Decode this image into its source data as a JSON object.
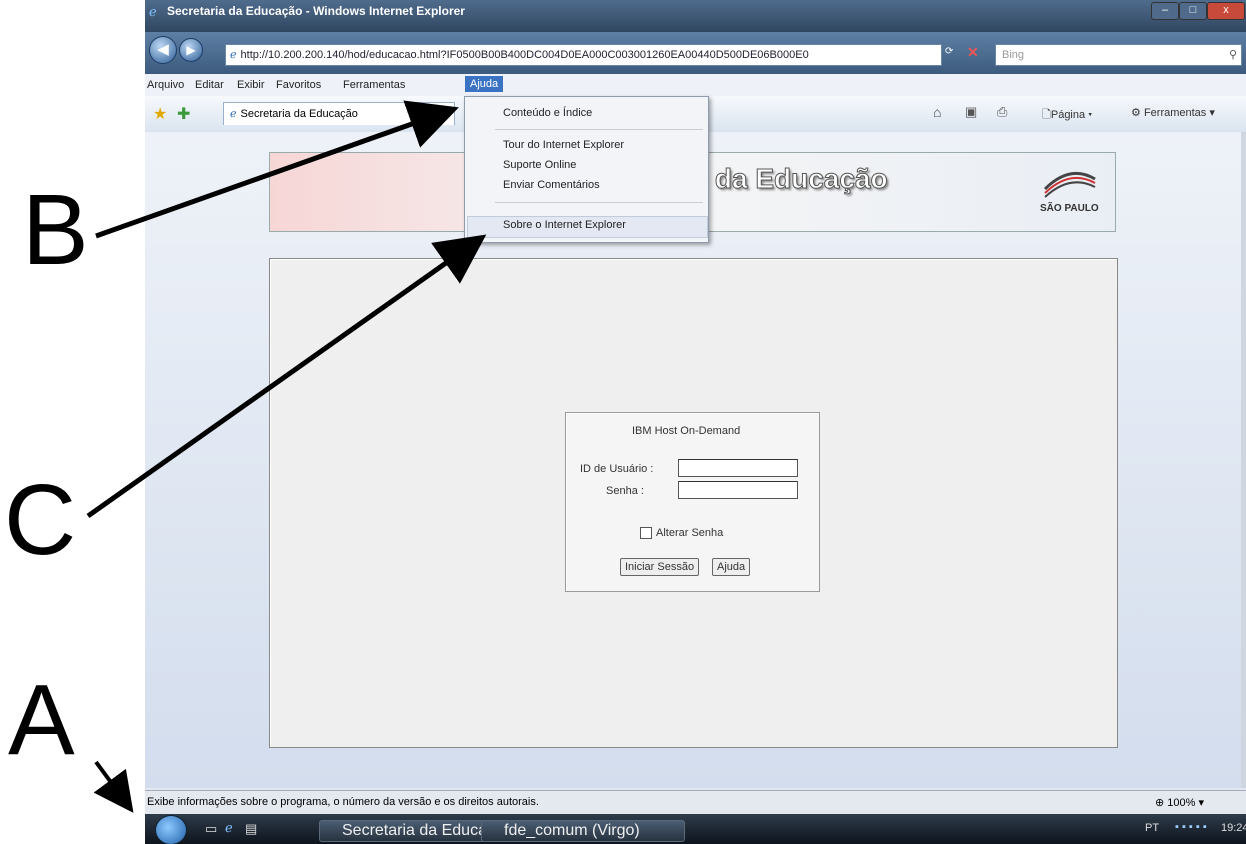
{
  "window": {
    "title": "Secretaria da Educação - Windows Internet Explorer",
    "url": "http://10.200.200.140/hod/educacao.html?IF0500B00B400DC004D0EA000C003001260EA00440D500DE06B000E0",
    "search_placeholder": "Bing",
    "controls": {
      "minimize": "–",
      "maximize": "□",
      "close": "x"
    }
  },
  "menubar": {
    "items": [
      "Arquivo",
      "Editar",
      "Exibir",
      "Favoritos",
      "Ferramentas",
      "Ajuda"
    ],
    "active": "Ajuda"
  },
  "toolbar": {
    "tab_label": "Secretaria da Educação",
    "page_label": "Página",
    "tools_label": "Ferramentas"
  },
  "ajuda_menu": {
    "items": [
      "Conteúdo e Índice",
      "Tour do Internet Explorer",
      "Suporte Online",
      "Enviar Comentários",
      "Sobre o Internet Explorer"
    ]
  },
  "page": {
    "banner_title": "o da Educação",
    "logo_text": "SÃO PAULO",
    "login": {
      "title": "IBM Host On-Demand",
      "user_label": "ID de Usuário :",
      "password_label": "Senha :",
      "change_password_label": "Alterar Senha",
      "start_button": "Iniciar Sessão",
      "help_button": "Ajuda"
    }
  },
  "statusbar": {
    "text": "Exibe informações sobre o programa, o número da versão e os direitos autorais.",
    "zoom": "100%"
  },
  "taskbar": {
    "buttons": [
      "Secretaria da Educa...",
      "fde_comum (Virgo)"
    ],
    "language": "PT",
    "clock": "19:24"
  },
  "annotations": {
    "a": "A",
    "b": "B",
    "c": "C"
  },
  "colors": {
    "menu_highlight": "#3a73c4",
    "titlebar": "#30465f"
  }
}
